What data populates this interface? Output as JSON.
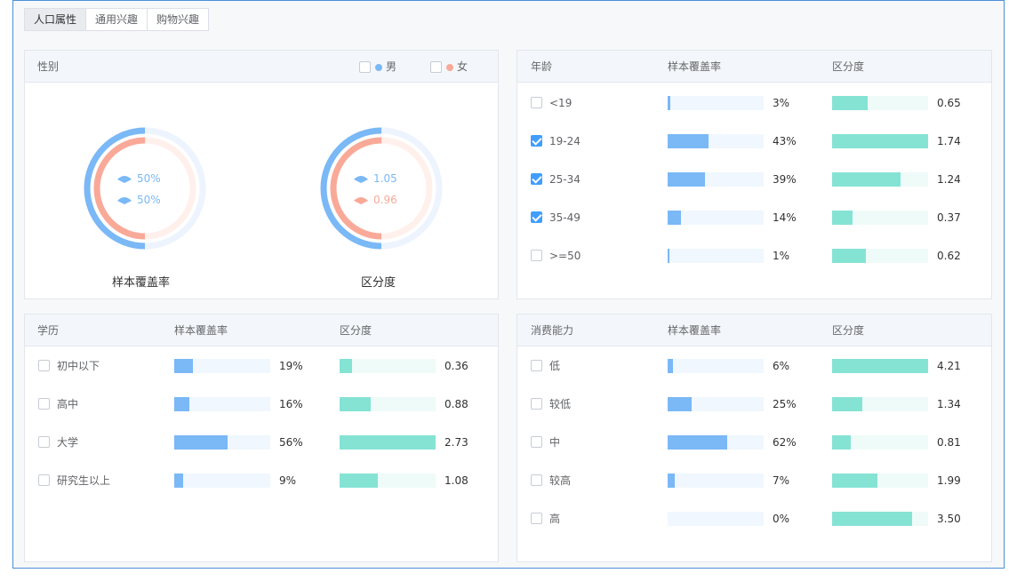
{
  "tabs": [
    {
      "label": "人口属性",
      "active": true
    },
    {
      "label": "通用兴趣",
      "active": false
    },
    {
      "label": "购物兴趣",
      "active": false
    }
  ],
  "colors": {
    "blue": "#7ab8f6",
    "pink": "#f9a998",
    "green": "#85e3d4",
    "checked": "#409eff"
  },
  "gender": {
    "title": "性别",
    "legend": [
      {
        "label": "男",
        "color": "#7ab8f6",
        "checked": false
      },
      {
        "label": "女",
        "color": "#f9a998",
        "checked": false
      }
    ],
    "coverage": {
      "caption": "样本覆盖率",
      "male_label": "50%",
      "female_label": "50%",
      "male_fraction": 0.5,
      "female_fraction": 0.5
    },
    "distinction": {
      "caption": "区分度",
      "male_label": "1.05",
      "female_label": "0.96",
      "male_fraction": 0.5,
      "female_fraction": 0.5
    }
  },
  "panels": {
    "age": {
      "headers": [
        "年龄",
        "样本覆盖率",
        "区分度"
      ],
      "rows": [
        {
          "label": "<19",
          "checked": false,
          "coverage": "3%",
          "coverage_value": 3,
          "distinction": "0.65",
          "distinction_value": 0.65
        },
        {
          "label": "19-24",
          "checked": true,
          "coverage": "43%",
          "coverage_value": 43,
          "distinction": "1.74",
          "distinction_value": 1.74
        },
        {
          "label": "25-34",
          "checked": true,
          "coverage": "39%",
          "coverage_value": 39,
          "distinction": "1.24",
          "distinction_value": 1.24
        },
        {
          "label": "35-49",
          "checked": true,
          "coverage": "14%",
          "coverage_value": 14,
          "distinction": "0.37",
          "distinction_value": 0.37
        },
        {
          "label": ">=50",
          "checked": false,
          "coverage": "1%",
          "coverage_value": 1,
          "distinction": "0.62",
          "distinction_value": 0.62
        }
      ]
    },
    "education": {
      "headers": [
        "学历",
        "样本覆盖率",
        "区分度"
      ],
      "rows": [
        {
          "label": "初中以下",
          "checked": false,
          "coverage": "19%",
          "coverage_value": 19,
          "distinction": "0.36",
          "distinction_value": 0.36
        },
        {
          "label": "高中",
          "checked": false,
          "coverage": "16%",
          "coverage_value": 16,
          "distinction": "0.88",
          "distinction_value": 0.88
        },
        {
          "label": "大学",
          "checked": false,
          "coverage": "56%",
          "coverage_value": 56,
          "distinction": "2.73",
          "distinction_value": 2.73
        },
        {
          "label": "研究生以上",
          "checked": false,
          "coverage": "9%",
          "coverage_value": 9,
          "distinction": "1.08",
          "distinction_value": 1.08
        }
      ]
    },
    "consumption": {
      "headers": [
        "消费能力",
        "样本覆盖率",
        "区分度"
      ],
      "rows": [
        {
          "label": "低",
          "checked": false,
          "coverage": "6%",
          "coverage_value": 6,
          "distinction": "4.21",
          "distinction_value": 4.21
        },
        {
          "label": "较低",
          "checked": false,
          "coverage": "25%",
          "coverage_value": 25,
          "distinction": "1.34",
          "distinction_value": 1.34
        },
        {
          "label": "中",
          "checked": false,
          "coverage": "62%",
          "coverage_value": 62,
          "distinction": "0.81",
          "distinction_value": 0.81
        },
        {
          "label": "较高",
          "checked": false,
          "coverage": "7%",
          "coverage_value": 7,
          "distinction": "1.99",
          "distinction_value": 1.99
        },
        {
          "label": "高",
          "checked": false,
          "coverage": "0%",
          "coverage_value": 0,
          "distinction": "3.50",
          "distinction_value": 3.5
        }
      ]
    }
  }
}
